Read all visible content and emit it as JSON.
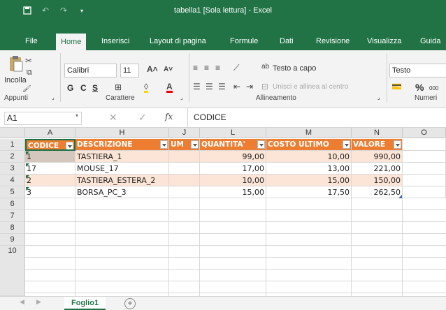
{
  "titlebar": {
    "title": "tabella1  [Sola lettura]  -  Excel"
  },
  "tabs": [
    "File",
    "Home",
    "Inserisci",
    "Layout di pagina",
    "Formule",
    "Dati",
    "Revisione",
    "Visualizza",
    "Guida"
  ],
  "ribbon": {
    "paste_label": "Incolla",
    "font_name": "Calibri",
    "font_size": "11",
    "bold": "G",
    "italic": "C",
    "underline": "S",
    "wrap_text": "Testo a capo",
    "merge_center": "Unisci e allinea al centro",
    "number_format": "Testo",
    "percent": "%",
    "thousands": "000",
    "groups": {
      "clipboard": "Appunti",
      "font": "Carattere",
      "alignment": "Allineamento",
      "number": "Numeri"
    }
  },
  "formula_bar": {
    "name_box": "A1",
    "fx": "fx",
    "content": "CODICE"
  },
  "columns": [
    "A",
    "H",
    "J",
    "L",
    "M",
    "N",
    "O"
  ],
  "rows": [
    "1",
    "2",
    "3",
    "4",
    "5",
    "6",
    "7",
    "8",
    "9",
    "10"
  ],
  "table": {
    "headers": [
      "CODICE",
      "DESCRIZIONE",
      "UM",
      "QUANTITA'",
      "COSTO ULTIMO",
      "VALORE"
    ],
    "rows": [
      [
        "1",
        "TASTIERA_1",
        "",
        "99,00",
        "10,00",
        "990,00"
      ],
      [
        "17",
        "MOUSE_17",
        "",
        "17,00",
        "13,00",
        "221,00"
      ],
      [
        "2",
        "TASTIERA_ESTERA_2",
        "",
        "10,00",
        "15,00",
        "150,00"
      ],
      [
        "3",
        "BORSA_PC_3",
        "",
        "15,00",
        "17,50",
        "262,50"
      ]
    ]
  },
  "sheet": {
    "tab_name": "Foglio1",
    "add_symbol": "+"
  },
  "colors": {
    "excel_green": "#217346",
    "header_orange": "#ed7d31",
    "band_peach": "#fce4d6"
  }
}
